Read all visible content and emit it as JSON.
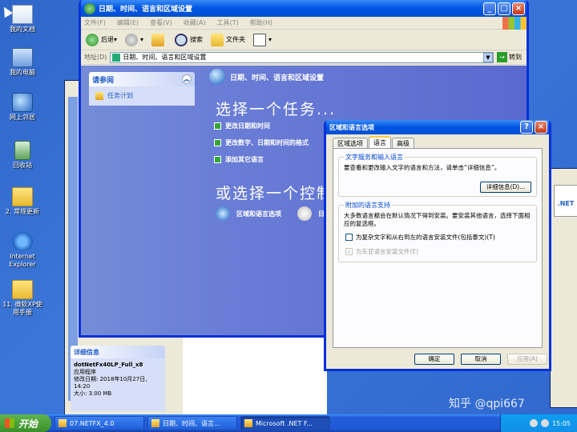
{
  "desktop_icons": [
    {
      "label": "我的文档"
    },
    {
      "label": "我的电脑"
    },
    {
      "label": "网上邻居"
    },
    {
      "label": "回收站"
    },
    {
      "label": "2. 常规更新"
    },
    {
      "label": "Internet Explorer"
    },
    {
      "label": "11. 微软XP使用手册"
    }
  ],
  "main_window": {
    "title": "日期、时间、语言和区域设置",
    "menu": [
      "文件(F)",
      "编辑(E)",
      "查看(V)",
      "收藏(A)",
      "工具(T)",
      "帮助(H)"
    ],
    "toolbar": {
      "back": "后退",
      "search": "搜索",
      "folders": "文件夹"
    },
    "address_label": "地址(D)",
    "address_value": "日期、时间、语言和区域设置",
    "go_label": "转到",
    "see_also_header": "请参阅",
    "see_also_item": "任务计划",
    "category_header": "日期、时间、语言和区域设置",
    "pick_task": "选择一个任务...",
    "tasks": [
      "更改日期和时间",
      "更改数字、日期和时间的格式",
      "添加其它语言"
    ],
    "pick_icon": "或选择一个控制",
    "cp_items": [
      "区域和语言选项",
      "日"
    ]
  },
  "details": {
    "header": "详细信息",
    "filename": "dotNetFx40LP_Full_x8",
    "type": "应用程序",
    "modified": "修改日期: 2018年10月27日, 14:20",
    "size": "大小: 3.00 MB"
  },
  "dialog": {
    "title": "区域和语言选项",
    "tabs": [
      "区域选项",
      "语言",
      "高级"
    ],
    "group1_title": "文字服务和输入语言",
    "group1_text": "要查看和更改输入文字的语言和方法，请单击“详细信息”。",
    "details_button": "详细信息(D)...",
    "group2_title": "附加的语言支持",
    "group2_text": "大多数语言都会在默认情况下得到安装。要安装其他语言，选择下面相应的复选框。",
    "check1": "为复杂文字和从右到左的语言安装文件(包括泰文)(T)",
    "check2": "为东亚语言安装文件(E)",
    "ok": "确定",
    "cancel": "取消",
    "apply": "应用(A)"
  },
  "taskbar": {
    "start": "开始",
    "tasks": [
      "07.NETFX_4.0",
      "日期、时间、语言...",
      "Microsoft .NET F..."
    ],
    "clock": "15:05"
  },
  "right_window_logo": ".NET",
  "watermark": "知乎 @qpi667"
}
